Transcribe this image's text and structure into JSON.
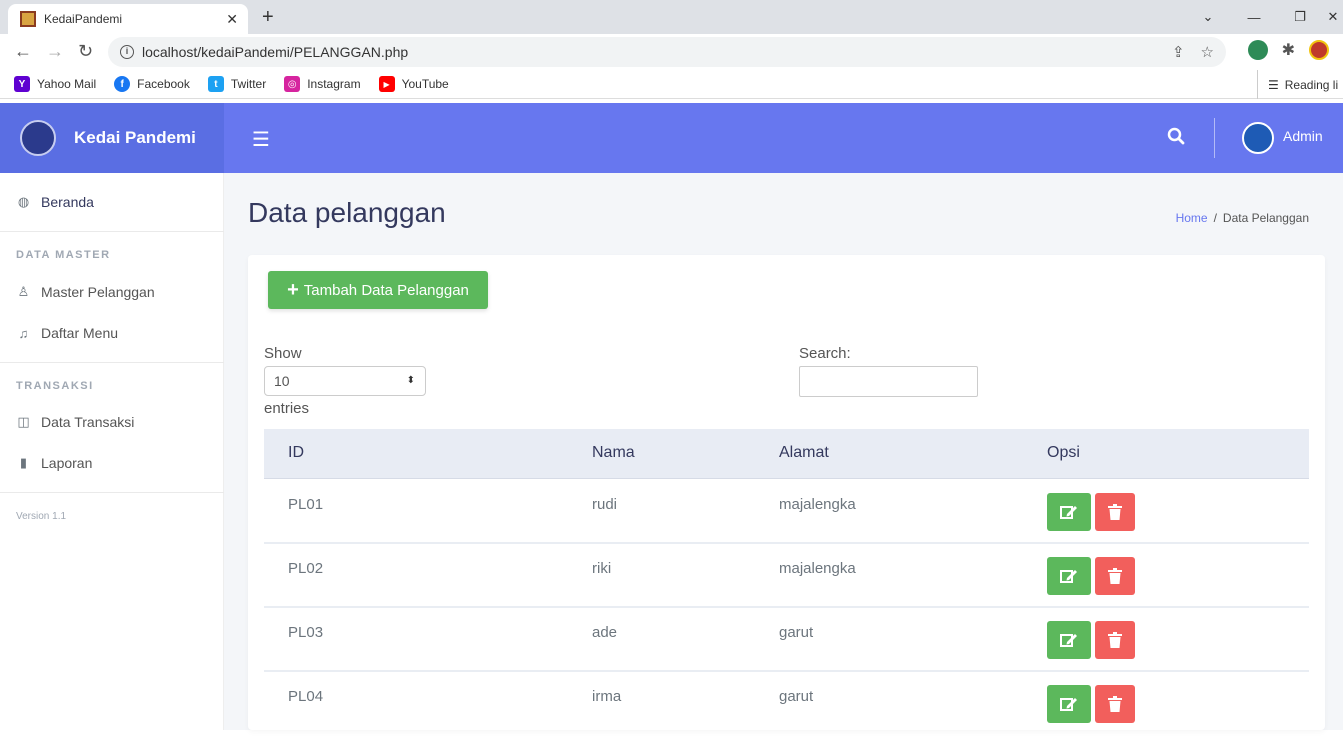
{
  "browser": {
    "tab_title": "KedaiPandemi",
    "tab_close": "✕",
    "new_tab": "+",
    "url": "localhost/kedaiPandemi/PELANGGAN.php",
    "bookmarks": [
      {
        "label": "Yahoo Mail",
        "icon": "yahoo-icon",
        "color": "#5f01d1",
        "glyph": "Y"
      },
      {
        "label": "Facebook",
        "icon": "facebook-icon",
        "color": "#1877f2",
        "glyph": "f"
      },
      {
        "label": "Twitter",
        "icon": "twitter-icon",
        "color": "#1da1f2",
        "glyph": "t"
      },
      {
        "label": "Instagram",
        "icon": "instagram-icon",
        "color": "#d6249f",
        "glyph": "◎"
      },
      {
        "label": "YouTube",
        "icon": "youtube-icon",
        "color": "#ff0000",
        "glyph": "▶"
      }
    ],
    "reading_list": "Reading li"
  },
  "app": {
    "brand": "Kedai Pandemi",
    "user": "Admin",
    "colors": {
      "topbar": "#6777ef",
      "brand": "#5a6ee3",
      "success": "#5cb85c",
      "danger": "#f25f5c"
    }
  },
  "sidebar": {
    "beranda": "Beranda",
    "section_master": "DATA MASTER",
    "master_pelanggan": "Master Pelanggan",
    "daftar_menu": "Daftar Menu",
    "section_transaksi": "TRANSAKSI",
    "data_transaksi": "Data Transaksi",
    "laporan": "Laporan",
    "version": "Version 1.1"
  },
  "page": {
    "title": "Data pelanggan",
    "breadcrumb_home": "Home",
    "breadcrumb_sep": "/",
    "breadcrumb_current": "Data Pelanggan",
    "add_button": "Tambah Data Pelanggan",
    "show_label": "Show",
    "page_length": "10",
    "entries_label": "entries",
    "search_label": "Search:"
  },
  "table": {
    "headers": [
      "ID",
      "Nama",
      "Alamat",
      "Opsi"
    ],
    "rows": [
      [
        "PL01",
        "rudi",
        "majalengka"
      ],
      [
        "PL02",
        "riki",
        "majalengka"
      ],
      [
        "PL03",
        "ade",
        "garut"
      ],
      [
        "PL04",
        "irma",
        "garut"
      ]
    ]
  }
}
